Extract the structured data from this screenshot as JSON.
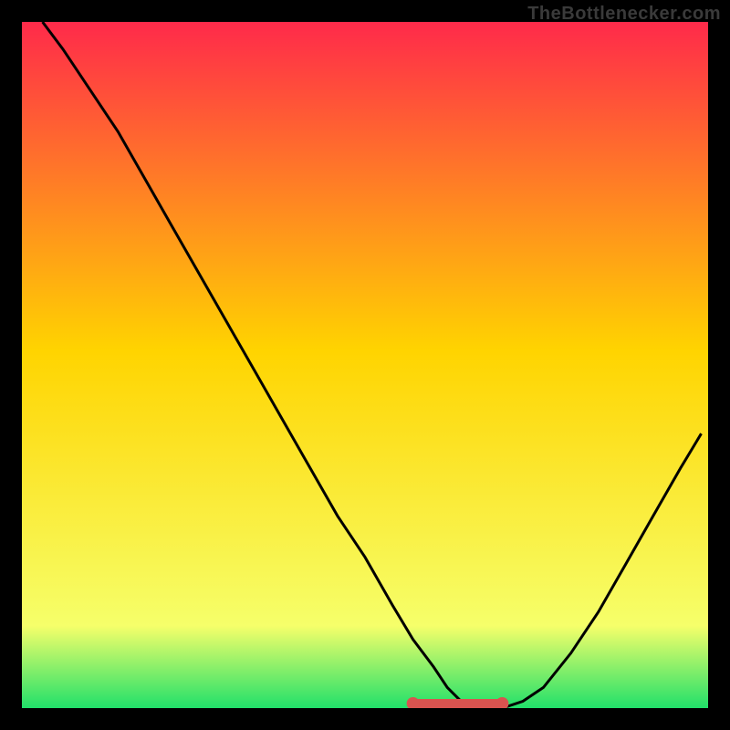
{
  "watermark": "TheBottlenecker.com",
  "chart_data": {
    "type": "line",
    "title": "",
    "xlabel": "",
    "ylabel": "",
    "xlim": [
      0,
      100
    ],
    "ylim": [
      0,
      100
    ],
    "grid": false,
    "background_gradient": {
      "top": "#ff2a4a",
      "mid": "#ffd400",
      "low": "#f6ff6a",
      "bottom": "#21e06a"
    },
    "series": [
      {
        "name": "bottleneck-curve",
        "stroke": "#000000",
        "x": [
          3,
          6,
          10,
          14,
          18,
          22,
          26,
          30,
          34,
          38,
          42,
          46,
          50,
          54,
          57,
          60,
          62,
          64,
          66,
          68,
          70,
          73,
          76,
          80,
          84,
          88,
          92,
          96,
          99
        ],
        "values": [
          100,
          96,
          90,
          84,
          77,
          70,
          63,
          56,
          49,
          42,
          35,
          28,
          22,
          15,
          10,
          6,
          3,
          1,
          0,
          0,
          0,
          1,
          3,
          8,
          14,
          21,
          28,
          35,
          40
        ]
      },
      {
        "name": "highlight-band",
        "type": "marker-band",
        "stroke": "#d9534f",
        "x_range": [
          57,
          70
        ],
        "y": 0
      }
    ],
    "markers": [
      {
        "name": "band-start-dot",
        "x": 57,
        "y": 0,
        "color": "#d9534f"
      },
      {
        "name": "band-end-dot",
        "x": 70,
        "y": 0,
        "color": "#d9534f"
      }
    ]
  }
}
